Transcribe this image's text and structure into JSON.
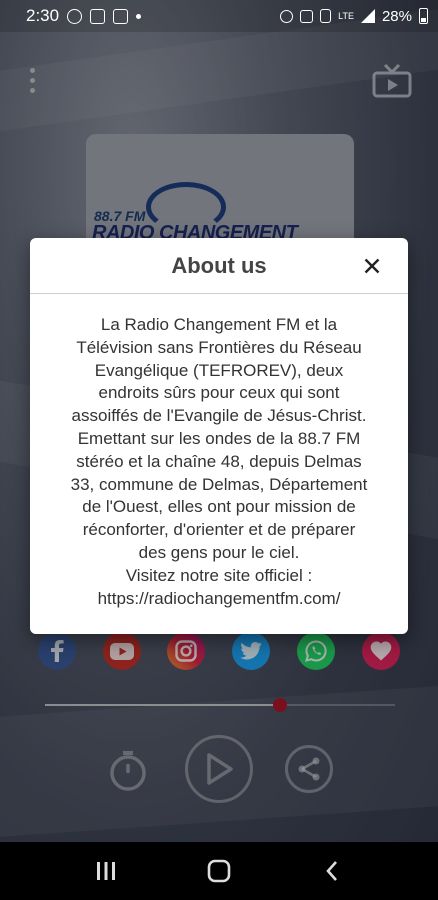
{
  "status_bar": {
    "time": "2:30",
    "battery": "28%",
    "network": "LTE",
    "left_icons": [
      "whatsapp-icon",
      "gallery-icon",
      "sim-icon",
      "dot-icon"
    ],
    "right_icons": [
      "alarm-icon",
      "mute-icon",
      "vibrate-icon",
      "signal-icon",
      "battery-icon"
    ]
  },
  "header": {
    "menu_icon": "more-vert-icon",
    "cast_icon": "tv-icon"
  },
  "logo": {
    "frequency": "88.7 FM",
    "name": "RADIO CHANGEMENT"
  },
  "dialog": {
    "title": "About us",
    "close_icon": "close-icon",
    "lines": [
      "La Radio Changement FM et la",
      "Télévision sans Frontières du Réseau",
      "Evangélique (TEFROREV), deux",
      "endroits sûrs pour ceux qui sont",
      "assoiffés de l'Evangile de Jésus-Christ.",
      "Emettant sur les ondes de la 88.7 FM",
      "stéréo et la chaîne 48, depuis Delmas",
      "33, commune de Delmas, Département",
      "de l'Ouest, elles ont pour mission de",
      "réconforter, d'orienter et de préparer",
      "des gens pour le ciel.",
      "Visitez notre site officiel :",
      "https://radiochangementfm.com/"
    ]
  },
  "social": [
    {
      "name": "facebook",
      "color": "#3b5998"
    },
    {
      "name": "youtube",
      "color": "#c4302b"
    },
    {
      "name": "instagram",
      "color": "#c13584"
    },
    {
      "name": "twitter",
      "color": "#1da1f2"
    },
    {
      "name": "whatsapp",
      "color": "#25d366"
    },
    {
      "name": "favorite",
      "color": "#e0245e"
    }
  ],
  "player": {
    "progress_fraction": 0.67,
    "thumb_color": "#a9162a",
    "controls": [
      "timer-icon",
      "play-icon",
      "share-icon"
    ]
  },
  "nav": {
    "buttons": [
      "recents-icon",
      "home-icon",
      "back-icon"
    ]
  }
}
